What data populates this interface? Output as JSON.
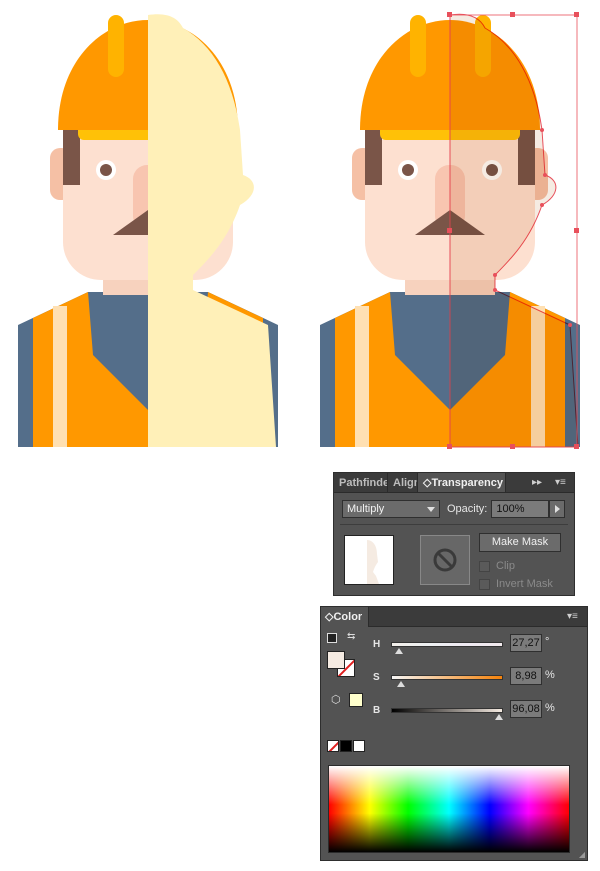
{
  "transparency_panel": {
    "tabs": [
      "Pathfinder",
      "Align",
      "Transparency"
    ],
    "active_tab": "Transparency",
    "blend_mode": "Multiply",
    "opacity_label": "Opacity:",
    "opacity_value": "100%",
    "make_mask_label": "Make Mask",
    "clip_label": "Clip",
    "invert_mask_label": "Invert Mask",
    "clip_checked": false,
    "invert_mask_checked": false
  },
  "color_panel": {
    "title": "Color",
    "sliders": [
      {
        "label": "H",
        "value": "27,27",
        "unit": "°",
        "fraction": 0.0758
      },
      {
        "label": "S",
        "value": "8,98",
        "unit": "%",
        "fraction": 0.0898
      },
      {
        "label": "B",
        "value": "96,08",
        "unit": "%",
        "fraction": 0.9608
      }
    ],
    "fill_color": "#F5EBE2",
    "out_of_gamut_swatch": "#FFFFCC"
  },
  "colors": {
    "helmet": "#FF9800",
    "helmet_stripe": "#FFB300",
    "helmet_brim": "#FFC107",
    "skin": "#FDE0D0",
    "neck": "#F7D2BE",
    "hair": "#7A5548",
    "vest": "#FF9800",
    "vest_stripe": "#FFE0B2",
    "shirt": "#546E8A",
    "shape_overlay": "#FFF0B8",
    "selection": "#E8505B"
  }
}
